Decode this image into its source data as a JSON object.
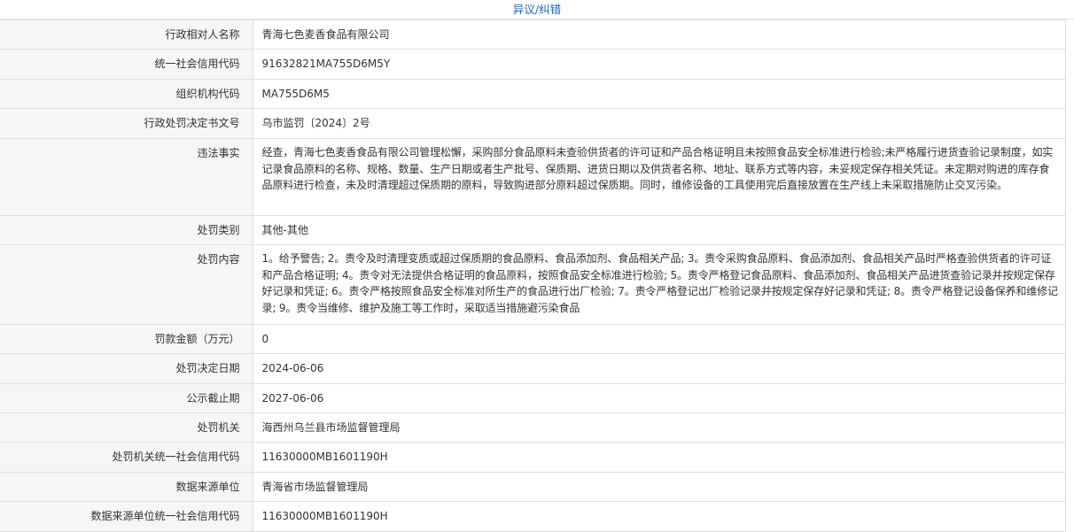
{
  "top_link": "异议/纠错",
  "rows": [
    {
      "label": "行政相对人名称",
      "value": "青海七色麦香食品有限公司"
    },
    {
      "label": "统一社会信用代码",
      "value": "91632821MA755D6M5Y"
    },
    {
      "label": "组织机构代码",
      "value": "MA755D6M5"
    },
    {
      "label": "行政处罚决定书文号",
      "value": "乌市监罚〔2024〕2号"
    },
    {
      "label": "违法事实",
      "value": " 经查，青海七色麦香食品有限公司管理松懈，采购部分食品原料未查验供货者的许可证和产品合格证明且未按照食品安全标准进行检验;未严格履行进货查验记录制度，如实记录食品原料的名称、规格、数量、生产日期或者生产批号、保质期、进货日期以及供货者名称、地址、联系方式等内容，未妥规定保存相关凭证。未定期对购进的库存食品原料进行检查，未及时清理超过保质期的原料，导致购进部分原料超过保质期。同时，维修设备的工具使用完后直接放置在生产线上未采取措施防止交叉污染。"
    },
    {
      "label": "处罚类别",
      "value": "其他-其他"
    },
    {
      "label": "处罚内容",
      "value": "1。给予警告; 2。责令及时清理变质或超过保质期的食品原料、食品添加剂、食品相关产品; 3。责令采购食品原料、食品添加剂、食品相关产品时严格查验供货者的许可证和产品合格证明; 4。责令对无法提供合格证明的食品原料，按照食品安全标准进行检验; 5。责令严格登记食品原料、食品添加剂、食品相关产品进货查验记录并按规定保存好记录和凭证; 6。责令严格按照食品安全标准对所生产的食品进行出厂检验; 7。责令严格登记出厂检验记录并按规定保存好记录和凭证; 8。责令严格登记设备保养和维修记录; 9。责令当维修、维护及施工等工作时，采取适当措施避污染食品"
    },
    {
      "label": "罚款金额（万元）",
      "value": "0"
    },
    {
      "label": "处罚决定日期",
      "value": "2024-06-06"
    },
    {
      "label": "公示截止期",
      "value": "2027-06-06"
    },
    {
      "label": "处罚机关",
      "value": "海西州乌兰县市场监督管理局"
    },
    {
      "label": "处罚机关统一社会信用代码",
      "value": "11630000MB1601190H"
    },
    {
      "label": "数据来源单位",
      "value": "青海省市场监督管理局"
    },
    {
      "label": "数据来源单位统一社会信用代码",
      "value": "11630000MB1601190H"
    }
  ]
}
